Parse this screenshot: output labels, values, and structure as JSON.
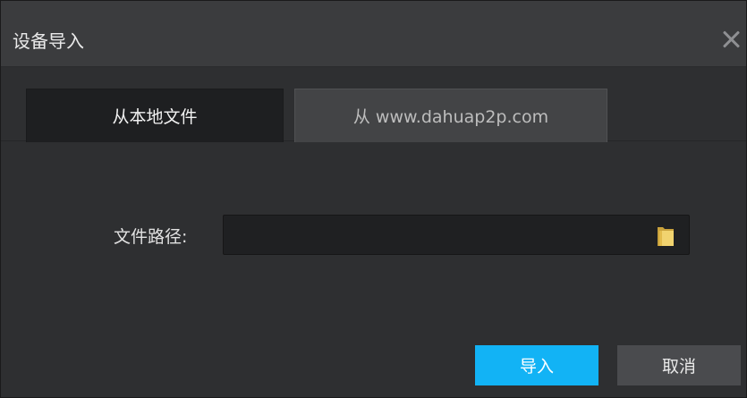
{
  "dialog": {
    "title": "设备导入",
    "close_icon": "close-icon"
  },
  "tabs": [
    {
      "label": "从本地文件",
      "active": true
    },
    {
      "label": "从 www.dahuap2p.com",
      "active": false
    }
  ],
  "form": {
    "path_label": "文件路径:",
    "path_value": "",
    "browse_icon": "folder-icon"
  },
  "buttons": {
    "import_label": "导入",
    "cancel_label": "取消"
  },
  "colors": {
    "accent": "#12b3f5",
    "folder": "#e8c75a"
  }
}
